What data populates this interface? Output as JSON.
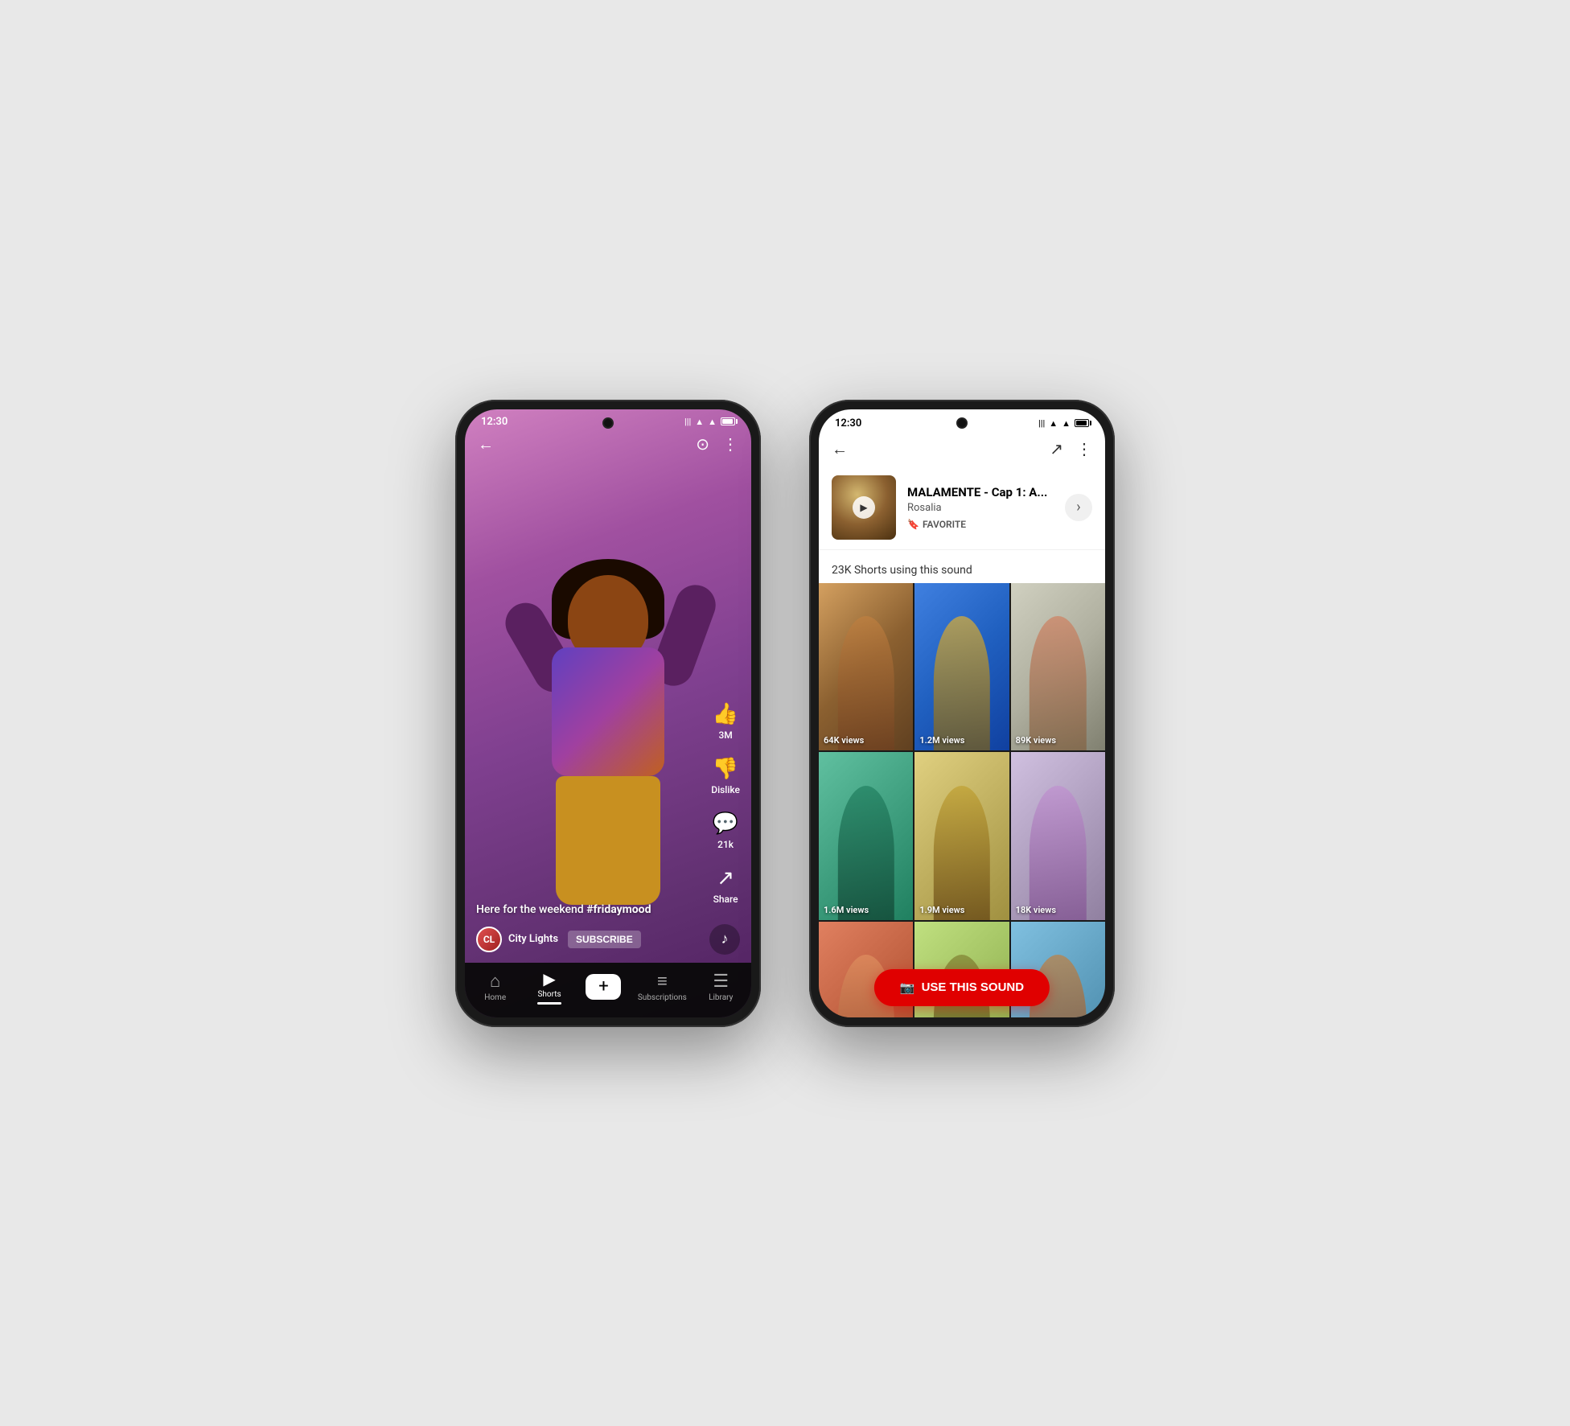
{
  "phone1": {
    "status": {
      "time": "12:30",
      "icons": [
        "vibrate",
        "wifi",
        "signal",
        "battery"
      ]
    },
    "header": {
      "back_icon": "←",
      "camera_icon": "⊙",
      "more_icon": "⋮"
    },
    "content": {
      "caption": "Here for the weekend",
      "hashtag": "#fridaymood",
      "channel_name": "City Lights",
      "subscribe_label": "SUBSCRIBE",
      "actions": {
        "like_count": "3M",
        "dislike_label": "Dislike",
        "comments_count": "21k",
        "share_label": "Share"
      }
    },
    "nav": {
      "items": [
        {
          "label": "Home",
          "icon": "⌂",
          "active": false
        },
        {
          "label": "Shorts",
          "icon": "▶",
          "active": true
        },
        {
          "label": "",
          "icon": "+",
          "active": false
        },
        {
          "label": "Subscriptions",
          "icon": "≡",
          "active": false
        },
        {
          "label": "Library",
          "icon": "📚",
          "active": false
        }
      ]
    }
  },
  "phone2": {
    "status": {
      "time": "12:30"
    },
    "header": {
      "back_icon": "←",
      "share_icon": "↗",
      "more_icon": "⋮"
    },
    "sound": {
      "title": "MALAMENTE - Cap 1: A...",
      "artist": "Rosalia",
      "favorite_label": "FAVORITE",
      "play_icon": "▶",
      "chevron": "›"
    },
    "shorts_count": "23K Shorts using this sound",
    "grid": [
      {
        "views": "64K views"
      },
      {
        "views": "1.2M views"
      },
      {
        "views": "89K views"
      },
      {
        "views": "1.6M views"
      },
      {
        "views": "1.9M views"
      },
      {
        "views": "18K views"
      },
      {
        "views": ""
      },
      {
        "views": ""
      },
      {
        "views": ""
      }
    ],
    "use_sound_button": {
      "icon": "⊙",
      "label": "USE THIS SOUND"
    }
  }
}
